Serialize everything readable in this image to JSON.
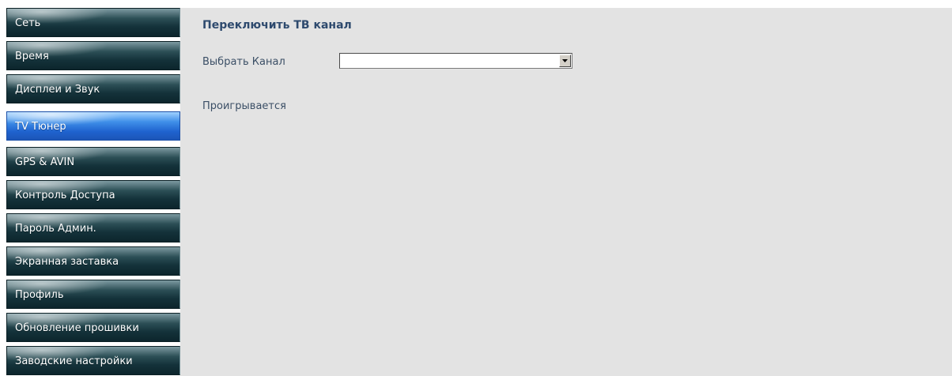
{
  "sidebar": {
    "items": [
      {
        "label": "Сеть"
      },
      {
        "label": "Время"
      },
      {
        "label": "Дисплеи и Звук"
      },
      {
        "label": "TV Тюнер"
      },
      {
        "label": "GPS & AVIN"
      },
      {
        "label": "Контроль Доступа"
      },
      {
        "label": "Пароль Админ."
      },
      {
        "label": "Экранная заставка"
      },
      {
        "label": "Профиль"
      },
      {
        "label": "Обновление прошивки"
      },
      {
        "label": "Заводские настройки"
      }
    ],
    "active_index": 3
  },
  "main": {
    "title": "Переключить ТВ канал",
    "channel_label": "Выбрать Канал",
    "channel_select_value": "",
    "status_label": "Проигрывается"
  },
  "colors": {
    "content_bg": "#e3e3e3",
    "title": "#2e4a6e",
    "active_tab": "#1f63cf",
    "inactive_tab": "#14323a"
  },
  "icons": {
    "select_arrow": "chevron-down-icon"
  }
}
